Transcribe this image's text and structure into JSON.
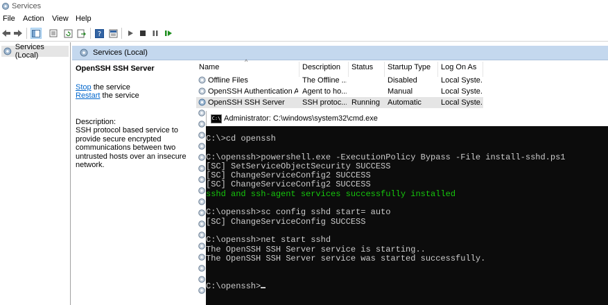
{
  "window": {
    "title": "Services"
  },
  "menu": [
    "File",
    "Action",
    "View",
    "Help"
  ],
  "tree": {
    "root": "Services (Local)"
  },
  "panel": {
    "title": "Services (Local)"
  },
  "description_pane": {
    "service_name": "OpenSSH SSH Server",
    "stop_link": "Stop",
    "stop_suffix": " the service",
    "restart_link": "Restart",
    "restart_suffix": " the service",
    "desc_label": "Description:",
    "desc_text": "SSH protocol based service to provide secure encrypted communications between two untrusted hosts over an insecure network."
  },
  "list": {
    "columns": [
      "Name",
      "Description",
      "Status",
      "Startup Type",
      "Log On As"
    ],
    "rows": [
      {
        "name": "Offline Files",
        "description": "The Offline ...",
        "status": "",
        "startup": "Disabled",
        "logon": "Local Syste..."
      },
      {
        "name": "OpenSSH Authentication A...",
        "description": "Agent to ho...",
        "status": "",
        "startup": "Manual",
        "logon": "Local Syste..."
      },
      {
        "name": "OpenSSH SSH Server",
        "description": "SSH protoc...",
        "status": "Running",
        "startup": "Automatic",
        "logon": "Local Syste..."
      }
    ]
  },
  "cmd": {
    "title": "Administrator: C:\\windows\\system32\\cmd.exe",
    "lines": [
      {
        "text": "C:\\>cd openssh",
        "color": "gray"
      },
      {
        "text": "",
        "color": "gray"
      },
      {
        "text": "C:\\openssh>powershell.exe -ExecutionPolicy Bypass -File install-sshd.ps1",
        "color": "gray"
      },
      {
        "text": "[SC] SetServiceObjectSecurity SUCCESS",
        "color": "gray"
      },
      {
        "text": "[SC] ChangeServiceConfig2 SUCCESS",
        "color": "gray"
      },
      {
        "text": "[SC] ChangeServiceConfig2 SUCCESS",
        "color": "gray"
      },
      {
        "text": "sshd and ssh-agent services successfully installed",
        "color": "green"
      },
      {
        "text": "",
        "color": "gray"
      },
      {
        "text": "C:\\openssh>sc config sshd start= auto",
        "color": "gray"
      },
      {
        "text": "[SC] ChangeServiceConfig SUCCESS",
        "color": "gray"
      },
      {
        "text": "",
        "color": "gray"
      },
      {
        "text": "C:\\openssh>net start sshd",
        "color": "gray"
      },
      {
        "text": "The OpenSSH SSH Server service is starting..",
        "color": "gray"
      },
      {
        "text": "The OpenSSH SSH Server service was started successfully.",
        "color": "gray"
      },
      {
        "text": "",
        "color": "gray"
      },
      {
        "text": "",
        "color": "gray"
      },
      {
        "text": "C:\\openssh>",
        "color": "gray"
      }
    ]
  },
  "colors": {
    "panel_header": "#c4d8ee",
    "link": "#0066cc",
    "terminal_bg": "#0c0c0c",
    "terminal_text": "#cccccc",
    "terminal_green": "#16c60c"
  }
}
